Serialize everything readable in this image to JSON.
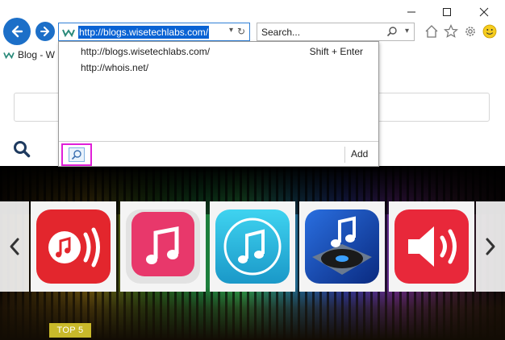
{
  "browser": {
    "address_url": "http://blogs.wisetechlabs.com/",
    "search_placeholder": "Search...",
    "tab_title": "Blog - W"
  },
  "autocomplete": {
    "items": [
      {
        "url": "http://blogs.wisetechlabs.com/",
        "shortcut": "Shift + Enter"
      },
      {
        "url": "http://whois.net/",
        "shortcut": ""
      }
    ],
    "add_label": "Add"
  },
  "page": {
    "banner_badge": "TOP 5",
    "carousel_icons": [
      "music-radio-icon",
      "itunes-icon",
      "music-note-circle-icon",
      "dj-turntable-icon",
      "speaker-volume-icon"
    ]
  },
  "colors": {
    "accent_blue": "#1c6fc8",
    "selection_blue": "#0a63d4",
    "highlight_magenta": "#e020d8",
    "badge_yellow": "#c9b92a"
  }
}
